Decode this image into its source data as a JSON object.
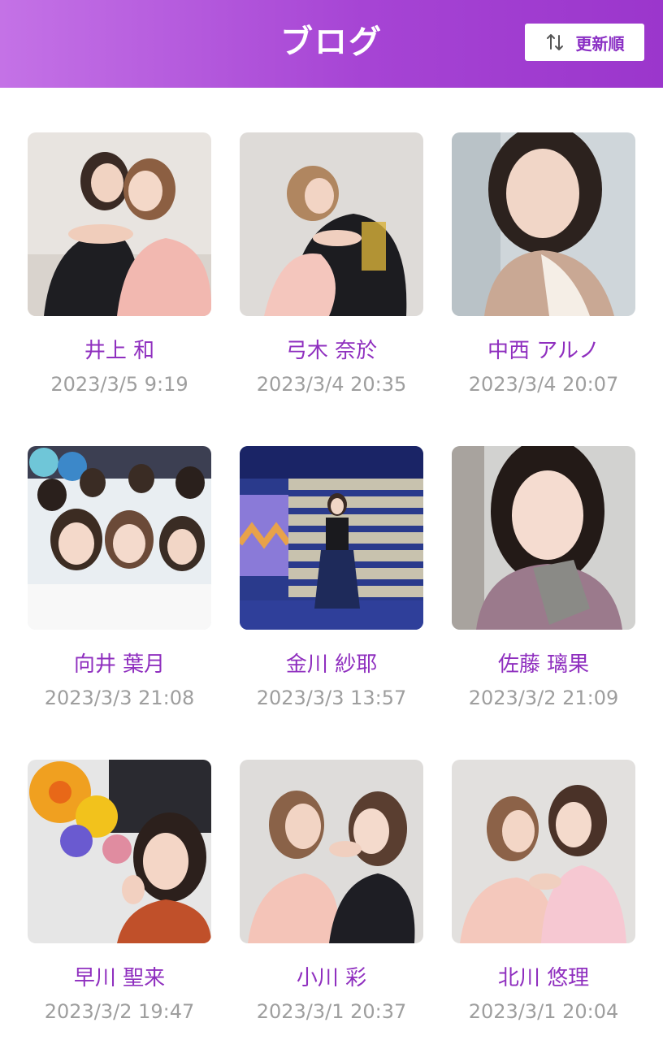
{
  "header": {
    "title": "ブログ",
    "sort_label": "更新順",
    "sort_icon": "sort-arrows-icon"
  },
  "posts": [
    {
      "name": "井上 和",
      "date": "2023/3/5 9:19"
    },
    {
      "name": "弓木 奈於",
      "date": "2023/3/4 20:35"
    },
    {
      "name": "中西 アルノ",
      "date": "2023/3/4 20:07"
    },
    {
      "name": "向井 葉月",
      "date": "2023/3/3 21:08"
    },
    {
      "name": "金川 紗耶",
      "date": "2023/3/3 13:57"
    },
    {
      "name": "佐藤 璃果",
      "date": "2023/3/2 21:09"
    },
    {
      "name": "早川 聖来",
      "date": "2023/3/2 19:47"
    },
    {
      "name": "小川 彩",
      "date": "2023/3/1 20:37"
    },
    {
      "name": "北川 悠理",
      "date": "2023/3/1 20:04"
    }
  ],
  "colors": {
    "header_start": "#c472e6",
    "header_end": "#9b36cc",
    "name_text": "#8f2fbf",
    "date_text": "#9e9e9e"
  }
}
